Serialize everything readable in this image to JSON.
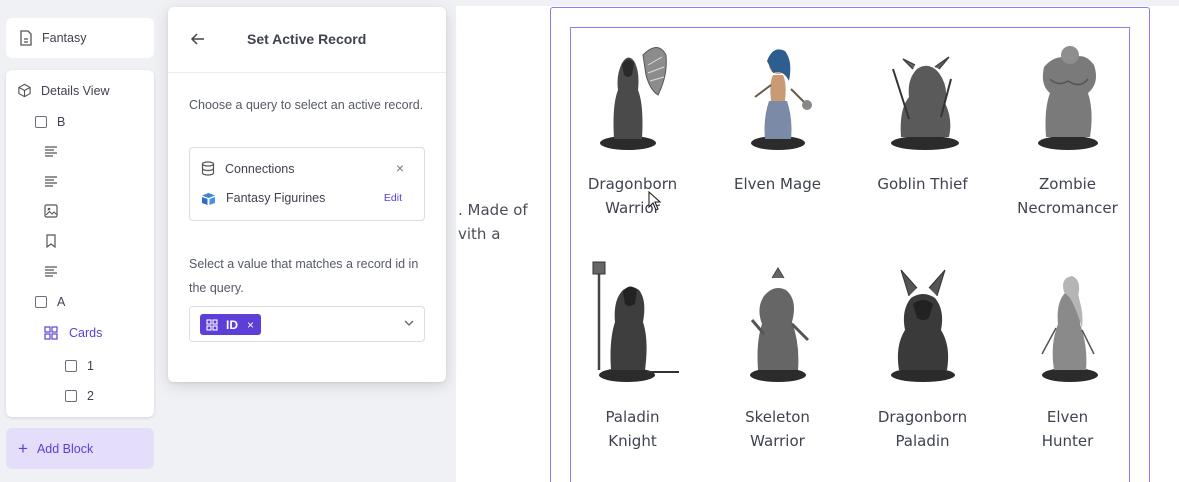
{
  "sidebar": {
    "page_label": "Fantasy",
    "details_view_label": "Details View",
    "items": [
      {
        "type": "checkbox",
        "label": "B"
      },
      {
        "type": "text-icon"
      },
      {
        "type": "text-icon"
      },
      {
        "type": "image-icon"
      },
      {
        "type": "bookmark-icon"
      },
      {
        "type": "text-icon"
      },
      {
        "type": "checkbox",
        "label": "A"
      },
      {
        "type": "cards",
        "label": "Cards"
      },
      {
        "type": "checkbox",
        "label": "1"
      },
      {
        "type": "checkbox",
        "label": "2"
      }
    ],
    "add_block_label": "Add Block"
  },
  "panel": {
    "title": "Set Active Record",
    "query_instruction": "Choose a query to select an active record.",
    "connections_label": "Connections",
    "query_name": "Fantasy Figurines",
    "edit_label": "Edit",
    "value_instruction": "Select a value that matches a record id in the query.",
    "selected_value": "ID",
    "chip_remove": "×",
    "close_glyph": "×"
  },
  "content": {
    "body_text_line1": ". Made of",
    "body_text_line2": "vith a",
    "cards": [
      {
        "name_line1": "Dragonborn",
        "name_line2": "Warrior"
      },
      {
        "name_line1": "Elven Mage",
        "name_line2": ""
      },
      {
        "name_line1": "Goblin Thief",
        "name_line2": ""
      },
      {
        "name_line1": "Zombie",
        "name_line2": "Necromancer"
      },
      {
        "name_line1": "Paladin",
        "name_line2": "Knight"
      },
      {
        "name_line1": "Skeleton",
        "name_line2": "Warrior"
      },
      {
        "name_line1": "Dragonborn",
        "name_line2": "Paladin"
      },
      {
        "name_line1": "Elven",
        "name_line2": "Hunter"
      }
    ]
  },
  "colors": {
    "accent": "#5b3fd6",
    "add_block_bg": "#e4defa",
    "frame": "#8b7ef0",
    "background": "#f0f1f4"
  }
}
